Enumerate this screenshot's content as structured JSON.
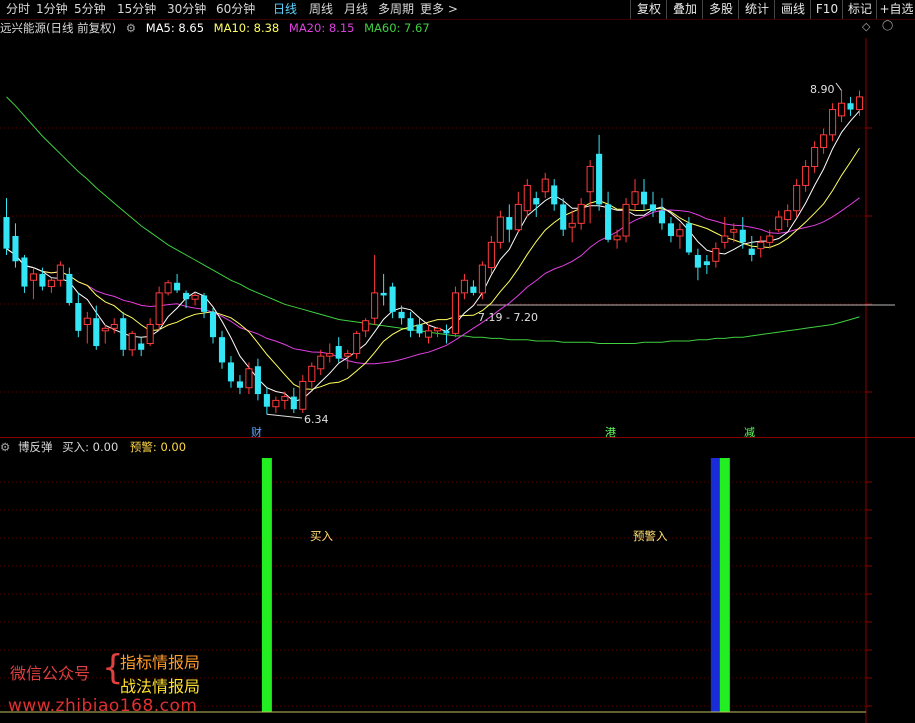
{
  "toolbar": {
    "periods": [
      {
        "label": "分时",
        "active": false
      },
      {
        "label": "1分钟",
        "active": false
      },
      {
        "label": "5分钟",
        "active": false
      },
      {
        "label": "15分钟",
        "active": false
      },
      {
        "label": "30分钟",
        "active": false
      },
      {
        "label": "60分钟",
        "active": false
      },
      {
        "label": "日线",
        "active": true
      },
      {
        "label": "周线",
        "active": false
      },
      {
        "label": "月线",
        "active": false
      },
      {
        "label": "多周期",
        "active": false
      },
      {
        "label": "更多 >",
        "active": false
      }
    ],
    "right_buttons": [
      "复权",
      "叠加",
      "多股",
      "统计",
      "画线",
      "F10",
      "标记",
      "+自选"
    ]
  },
  "chart_info": {
    "stock_name": "远兴能源(日线 前复权)",
    "ma5": "MA5: 8.65",
    "ma10": "MA10: 8.38",
    "ma20": "MA20: 8.15",
    "ma60": "MA60: 7.67"
  },
  "colors": {
    "up": "#ff3b3b",
    "down": "#33e5f5",
    "ma5": "#ffffff",
    "ma10": "#ffff60",
    "ma20": "#e040e0",
    "ma60": "#40d040",
    "buy_bar": "#22ee22",
    "warn_bar": "#1a2bd8",
    "grid": "#5a0000"
  },
  "price_annotations": {
    "high": "8.90",
    "low": "6.34",
    "gap": "7.19 - 7.20"
  },
  "event_markers": [
    "财",
    "港",
    "减"
  ],
  "indicator": {
    "name": "博反弹",
    "buy": "买入: 0.00",
    "warn": "预警: 0.00",
    "labels": [
      "买入",
      "预警入"
    ]
  },
  "watermark": {
    "account_label": "微信公众号",
    "line1": "指标情报局",
    "line2": "战法情报局",
    "url": "www.zhibiao168.com"
  },
  "chart_data": {
    "type": "candlestick",
    "candles": [
      [
        7.9,
        8.05,
        7.6,
        7.65
      ],
      [
        7.75,
        7.85,
        7.5,
        7.55
      ],
      [
        7.58,
        7.6,
        7.3,
        7.35
      ],
      [
        7.4,
        7.5,
        7.25,
        7.45
      ],
      [
        7.45,
        7.5,
        7.32,
        7.35
      ],
      [
        7.35,
        7.42,
        7.3,
        7.4
      ],
      [
        7.4,
        7.55,
        7.35,
        7.52
      ],
      [
        7.45,
        7.5,
        7.2,
        7.22
      ],
      [
        7.22,
        7.3,
        6.95,
        7.0
      ],
      [
        7.05,
        7.15,
        6.9,
        7.1
      ],
      [
        7.1,
        7.2,
        6.85,
        6.88
      ],
      [
        7.0,
        7.05,
        6.9,
        7.02
      ],
      [
        7.02,
        7.1,
        6.98,
        7.05
      ],
      [
        7.1,
        7.15,
        6.8,
        6.85
      ],
      [
        6.85,
        7.0,
        6.8,
        6.98
      ],
      [
        6.9,
        6.95,
        6.8,
        6.85
      ],
      [
        6.9,
        7.1,
        6.88,
        7.05
      ],
      [
        7.05,
        7.35,
        7.0,
        7.3
      ],
      [
        7.3,
        7.4,
        7.28,
        7.38
      ],
      [
        7.38,
        7.45,
        7.3,
        7.32
      ],
      [
        7.3,
        7.32,
        7.18,
        7.25
      ],
      [
        7.25,
        7.3,
        7.2,
        7.28
      ],
      [
        7.28,
        7.3,
        7.1,
        7.15
      ],
      [
        7.15,
        7.18,
        6.9,
        6.95
      ],
      [
        6.95,
        7.0,
        6.7,
        6.75
      ],
      [
        6.75,
        6.8,
        6.55,
        6.6
      ],
      [
        6.6,
        6.65,
        6.5,
        6.55
      ],
      [
        6.55,
        6.75,
        6.5,
        6.7
      ],
      [
        6.72,
        6.78,
        6.45,
        6.5
      ],
      [
        6.5,
        6.55,
        6.34,
        6.4
      ],
      [
        6.4,
        6.48,
        6.35,
        6.45
      ],
      [
        6.45,
        6.52,
        6.38,
        6.48
      ],
      [
        6.48,
        6.55,
        6.35,
        6.38
      ],
      [
        6.38,
        6.65,
        6.35,
        6.6
      ],
      [
        6.6,
        6.75,
        6.55,
        6.72
      ],
      [
        6.7,
        6.85,
        6.65,
        6.8
      ],
      [
        6.8,
        6.9,
        6.75,
        6.82
      ],
      [
        6.88,
        6.95,
        6.75,
        6.78
      ],
      [
        6.8,
        6.85,
        6.7,
        6.82
      ],
      [
        6.82,
        7.0,
        6.78,
        6.98
      ],
      [
        7.0,
        7.1,
        6.95,
        7.08
      ],
      [
        7.1,
        7.6,
        7.05,
        7.3
      ],
      [
        7.3,
        7.45,
        7.2,
        7.28
      ],
      [
        7.35,
        7.38,
        7.1,
        7.15
      ],
      [
        7.15,
        7.2,
        7.05,
        7.1
      ],
      [
        7.1,
        7.15,
        6.95,
        7.0
      ],
      [
        7.05,
        7.1,
        6.95,
        6.98
      ],
      [
        6.95,
        7.05,
        6.9,
        7.0
      ],
      [
        7.0,
        7.03,
        6.95,
        7.02
      ],
      [
        7.0,
        7.05,
        6.9,
        6.98
      ],
      [
        6.98,
        7.35,
        6.95,
        7.3
      ],
      [
        7.3,
        7.45,
        7.25,
        7.4
      ],
      [
        7.35,
        7.4,
        7.28,
        7.3
      ],
      [
        7.3,
        7.55,
        7.25,
        7.52
      ],
      [
        7.5,
        7.75,
        7.45,
        7.7
      ],
      [
        7.7,
        7.95,
        7.65,
        7.9
      ],
      [
        7.9,
        8.0,
        7.7,
        7.8
      ],
      [
        7.8,
        8.1,
        7.78,
        8.0
      ],
      [
        7.95,
        8.2,
        7.9,
        8.15
      ],
      [
        8.05,
        8.1,
        7.9,
        8.0
      ],
      [
        8.1,
        8.25,
        8.05,
        8.2
      ],
      [
        8.15,
        8.2,
        7.95,
        8.0
      ],
      [
        8.0,
        8.05,
        7.75,
        7.8
      ],
      [
        7.82,
        7.95,
        7.7,
        7.85
      ],
      [
        7.85,
        8.05,
        7.8,
        8.0
      ],
      [
        8.1,
        8.35,
        7.85,
        8.3
      ],
      [
        8.4,
        8.55,
        7.95,
        8.0
      ],
      [
        8.0,
        8.1,
        7.7,
        7.72
      ],
      [
        7.72,
        7.8,
        7.65,
        7.75
      ],
      [
        7.75,
        8.05,
        7.7,
        8.0
      ],
      [
        8.0,
        8.2,
        7.95,
        8.1
      ],
      [
        8.1,
        8.2,
        7.95,
        8.0
      ],
      [
        8.0,
        8.1,
        7.9,
        7.95
      ],
      [
        7.95,
        8.05,
        7.8,
        7.85
      ],
      [
        7.85,
        7.9,
        7.7,
        7.75
      ],
      [
        7.75,
        7.85,
        7.65,
        7.8
      ],
      [
        7.85,
        7.9,
        7.6,
        7.62
      ],
      [
        7.6,
        7.65,
        7.4,
        7.5
      ],
      [
        7.55,
        7.6,
        7.45,
        7.52
      ],
      [
        7.55,
        7.7,
        7.5,
        7.65
      ],
      [
        7.7,
        7.9,
        7.65,
        7.75
      ],
      [
        7.78,
        7.85,
        7.7,
        7.8
      ],
      [
        7.8,
        7.9,
        7.65,
        7.7
      ],
      [
        7.65,
        7.75,
        7.55,
        7.6
      ],
      [
        7.65,
        7.75,
        7.58,
        7.7
      ],
      [
        7.7,
        7.8,
        7.65,
        7.75
      ],
      [
        7.8,
        7.95,
        7.78,
        7.9
      ],
      [
        7.88,
        8.0,
        7.82,
        7.95
      ],
      [
        7.95,
        8.2,
        7.9,
        8.15
      ],
      [
        8.15,
        8.35,
        8.1,
        8.3
      ],
      [
        8.3,
        8.5,
        8.25,
        8.45
      ],
      [
        8.45,
        8.6,
        8.4,
        8.55
      ],
      [
        8.55,
        8.8,
        8.5,
        8.75
      ],
      [
        8.7,
        8.9,
        8.65,
        8.8
      ],
      [
        8.8,
        8.85,
        8.7,
        8.75
      ],
      [
        8.75,
        8.9,
        8.7,
        8.85
      ]
    ],
    "ma60": [
      8.85,
      8.78,
      8.7,
      8.62,
      8.54,
      8.47,
      8.4,
      8.33,
      8.26,
      8.2,
      8.13,
      8.07,
      8.01,
      7.95,
      7.89,
      7.83,
      7.78,
      7.73,
      7.68,
      7.64,
      7.6,
      7.56,
      7.52,
      7.48,
      7.44,
      7.4,
      7.37,
      7.33,
      7.3,
      7.27,
      7.24,
      7.21,
      7.19,
      7.17,
      7.15,
      7.13,
      7.11,
      7.09,
      7.08,
      7.07,
      7.06,
      7.05,
      7.04,
      7.03,
      7.02,
      7.01,
      7.0,
      6.99,
      6.98,
      6.97,
      6.96,
      6.96,
      6.95,
      6.95,
      6.94,
      6.94,
      6.93,
      6.93,
      6.93,
      6.92,
      6.92,
      6.92,
      6.91,
      6.91,
      6.91,
      6.91,
      6.9,
      6.9,
      6.9,
      6.9,
      6.9,
      6.91,
      6.91,
      6.91,
      6.92,
      6.92,
      6.92,
      6.93,
      6.93,
      6.94,
      6.94,
      6.95,
      6.95,
      6.96,
      6.97,
      6.98,
      6.99,
      7.0,
      7.01,
      7.02,
      7.03,
      7.04,
      7.05,
      7.07,
      7.09,
      7.11
    ],
    "signals": [
      {
        "index": 29,
        "kind": "buy",
        "value": 1
      },
      {
        "index": 79,
        "kind": "warn",
        "value": 1
      },
      {
        "index": 80,
        "kind": "buy",
        "value": 1
      }
    ]
  }
}
